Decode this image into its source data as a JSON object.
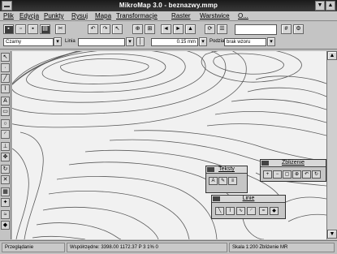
{
  "window": {
    "title": "MikroMap 3.0 - beznazwy.mmp",
    "minimize_glyph": "▼",
    "maximize_glyph": "▲"
  },
  "menu": [
    {
      "label": "Plik"
    },
    {
      "label": "Edycja"
    },
    {
      "label": "Punkty"
    },
    {
      "label": "Rysuj"
    },
    {
      "label": "Mapa"
    },
    {
      "label": "Transformacje"
    },
    {
      "label": "Raster"
    },
    {
      "label": "Warstwice"
    },
    {
      "label": "O..."
    }
  ],
  "toolbar": {
    "color_value": "Czarny",
    "line_label": "Linia",
    "line_value": "",
    "width_value": "0.15 mm",
    "hatch_label": "Podział",
    "hatch_value": "brak wzoru"
  },
  "palettes": {
    "teksty": {
      "title": "Teksty"
    },
    "zblizenie": {
      "title": "Zbliżenie"
    },
    "linie": {
      "title": "Linie"
    }
  },
  "status": {
    "left": "Przeglądanie",
    "middle": "Współrzędne: 3398.00  1172.37  P 3 1% 0",
    "right": "Skala 1:200  Zbliżenie  MR"
  },
  "colors": {
    "titlebar": "#1a1a1a",
    "canvas": "#f1f1f1",
    "contour": "#5a5a5a"
  }
}
